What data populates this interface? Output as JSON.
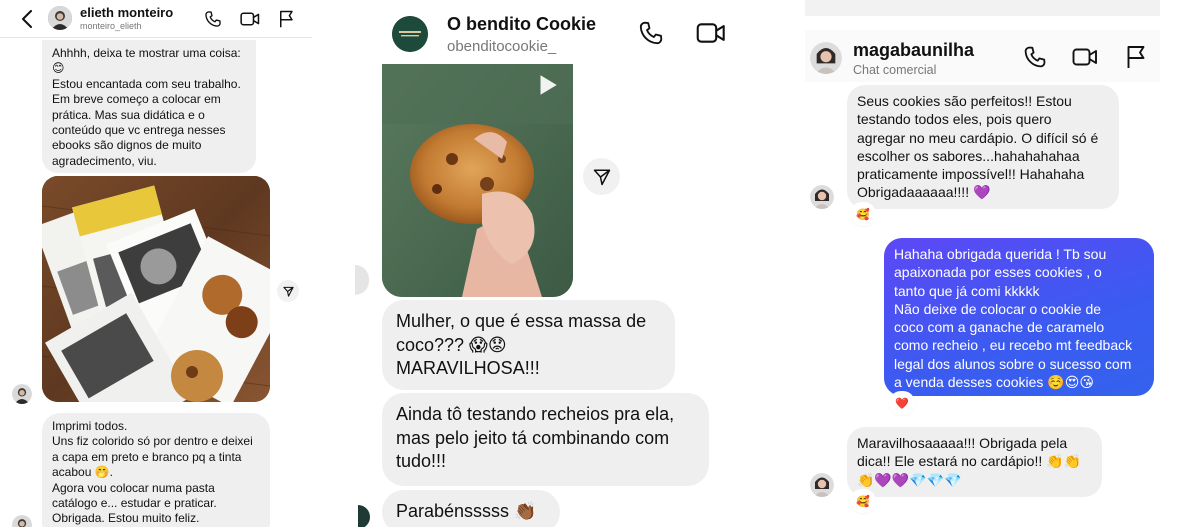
{
  "chat_left": {
    "contact_name": "elieth monteiro",
    "contact_handle": "monteiro_elieth",
    "messages": [
      {
        "text": "Ahhhh, deixa te mostrar uma coisa:\n😊\nEstou encantada com seu trabalho.\nEm breve começo a colocar em\nprática. Mas sua didática e o\nconteúdo que vc entrega nesses\nebooks são dignos de muito\nagradecimento, viu."
      },
      {
        "text": "Imprimi todos.\nUns fiz colorido só por dentro e deixei\na capa em preto e branco pq a tinta\nacabou 🤭.\nAgora vou colocar numa pasta\ncatálogo e... estudar e praticar.\nObrigada. Estou muito feliz."
      }
    ]
  },
  "chat_middle": {
    "contact_name": "O bendito Cookie",
    "contact_handle": "obenditocookie_",
    "messages": [
      {
        "text": "Mulher, o que é essa massa de\ncoco??? 😱😟\nMARAVILHOSA!!!"
      },
      {
        "text": "Ainda tô testando recheios pra ela,\nmas pelo jeito tá combinando com\ntudo!!!"
      },
      {
        "text": "Parabénsssss 👏🏾"
      }
    ]
  },
  "chat_right": {
    "contact_name": "magabaunilha",
    "contact_subtitle": "Chat comercial",
    "messages": [
      {
        "text": "Seus cookies são perfeitos!! Estou\ntestando todos eles, pois quero\nagregar no meu cardápio. O difícil só é\nescolher os sabores...hahahahahaa\npraticamente impossível!! Hahahaha\nObrigadaaaaaa!!!! 💜",
        "reaction": "🥰"
      },
      {
        "text": "Hahaha obrigada querida ! Tb sou\napaixonada por esses cookies , o\ntanto que já comi kkkkk\nNão deixe de colocar o cookie de\ncoco com a ganache de caramelo\ncomo recheio , eu recebo mt feedback\nlegal dos alunos sobre o sucesso com\na venda desses cookies ☺️😍😘",
        "reaction": "❤️"
      },
      {
        "text": "Maravilhosaaaaa!!! Obrigada pela\ndica!! Ele estará no cardápio!! 👏👏\n👏💜💜💎💎💎",
        "reaction": "🥰"
      }
    ]
  },
  "icon_names": [
    "back-chevron-icon",
    "phone-icon",
    "video-camera-icon",
    "flag-icon",
    "play-icon",
    "send-icon"
  ],
  "colors": {
    "outgoing_bubble": "#4a56f2",
    "incoming_bubble": "#efefef"
  }
}
